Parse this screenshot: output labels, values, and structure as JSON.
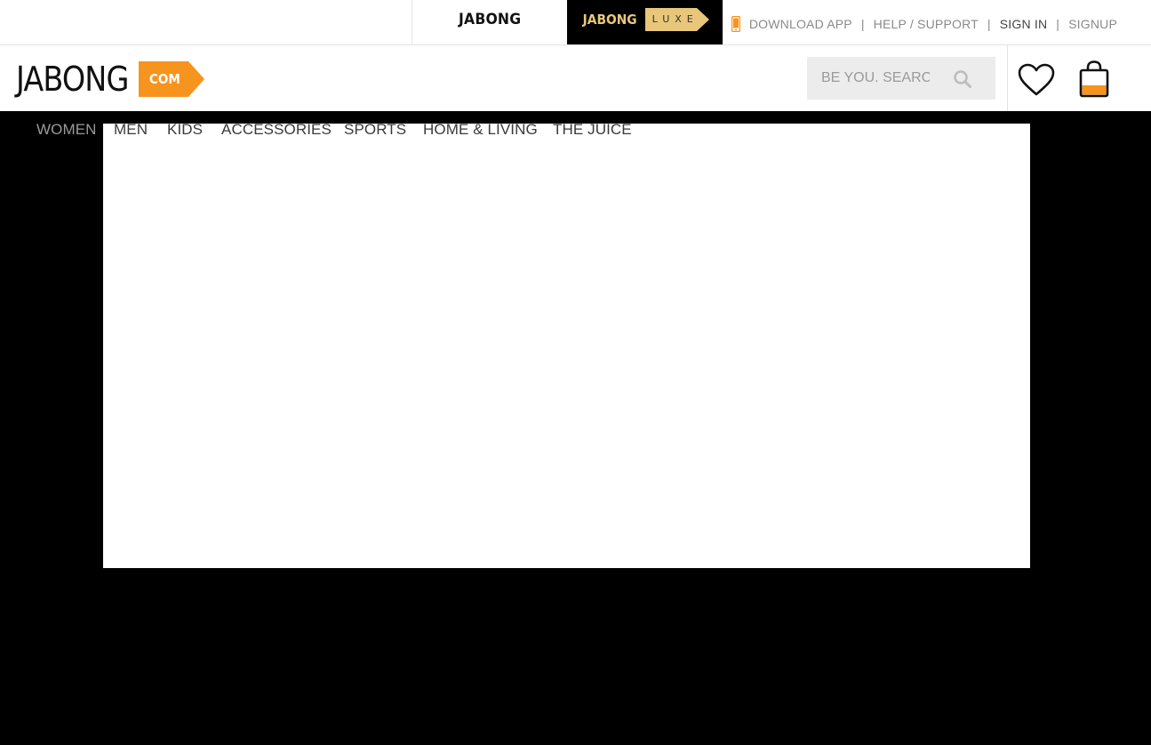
{
  "topbar": {
    "tab_jabong": "JABONG",
    "tab_luxe_brand": "JABONG",
    "tab_luxe_tag": "LUXE",
    "download_app": "DOWNLOAD APP",
    "separator": "|",
    "help_support": "HELP / SUPPORT",
    "sign_in": "SIGN IN",
    "signup": "SIGNUP"
  },
  "header": {
    "logo_word": "JABONG",
    "logo_tag": "COM",
    "search_placeholder": "BE YOU. SEARCH",
    "icons": {
      "search": "search-icon",
      "wishlist": "heart-icon",
      "bag": "shopping-bag-icon",
      "phone": "phone-icon"
    }
  },
  "nav": {
    "items": [
      "WOMEN",
      "MEN",
      "KIDS",
      "ACCESSORIES",
      "SPORTS",
      "HOME & LIVING",
      "THE JUICE"
    ]
  },
  "colors": {
    "brand_orange": "#f7941d",
    "luxe_gold": "#e9c77a",
    "overlay": "#000000"
  }
}
